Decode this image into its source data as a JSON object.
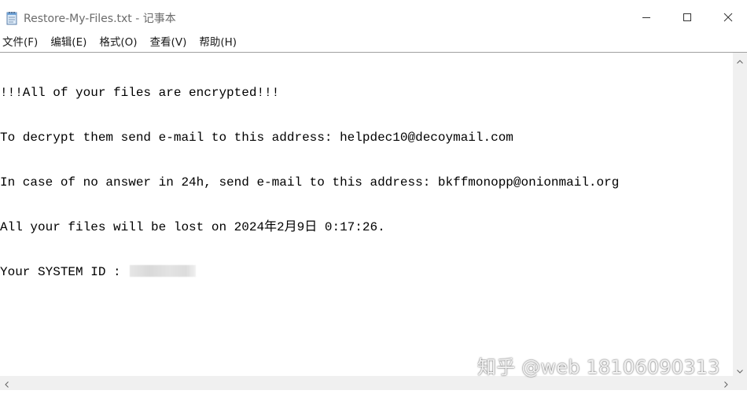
{
  "window": {
    "title": "Restore-My-Files.txt - 记事本"
  },
  "menu": {
    "items": [
      {
        "label": "文件(F)"
      },
      {
        "label": "编辑(E)"
      },
      {
        "label": "格式(O)"
      },
      {
        "label": "查看(V)"
      },
      {
        "label": "帮助(H)"
      }
    ]
  },
  "document": {
    "lines": [
      "!!!All of your files are encrypted!!!",
      "To decrypt them send e-mail to this address: helpdec10@decoymail.com",
      "In case of no answer in 24h, send e-mail to this address: bkffmonopp@onionmail.org",
      "All your files will be lost on 2024年2月9日 0:17:26.",
      "Your SYSTEM ID : "
    ]
  },
  "watermark": {
    "text": "知乎 @web 18106090313"
  },
  "icons": {
    "app": "notepad-icon",
    "minimize": "minimize-icon",
    "maximize": "maximize-icon",
    "close": "close-icon"
  }
}
